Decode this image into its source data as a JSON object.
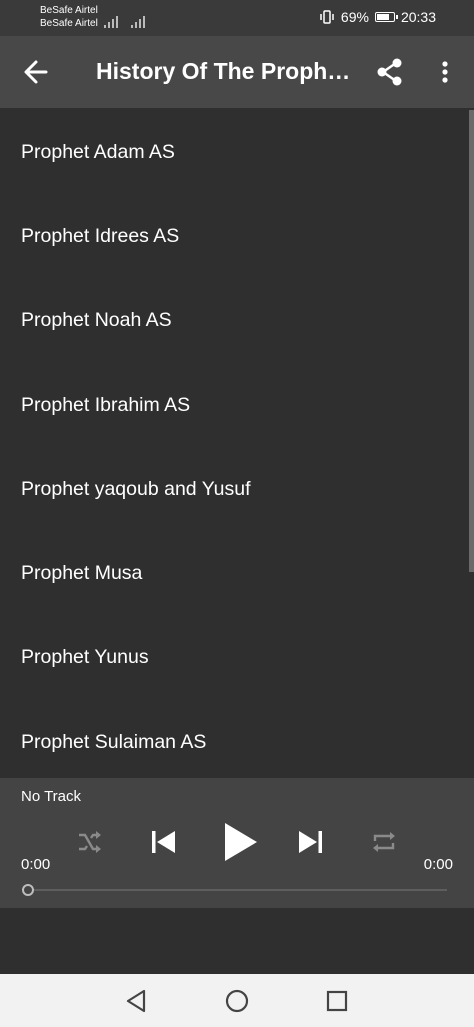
{
  "status_bar": {
    "carrier_1": "BeSafe Airtel",
    "carrier_2": "BeSafe Airtel",
    "battery_percent": "69%",
    "time": "20:33"
  },
  "app_bar": {
    "title": "History Of The Prophets",
    "back_icon": "arrow-left-icon",
    "share_icon": "share-icon",
    "more_icon": "more-vertical-icon"
  },
  "list": {
    "items": [
      "Prophet Adam AS",
      "Prophet Idrees AS",
      "Prophet Noah AS",
      "Prophet Ibrahim AS",
      "Prophet yaqoub and Yusuf",
      "Prophet Musa",
      "Prophet Yunus",
      "Prophet Sulaiman AS"
    ]
  },
  "player": {
    "track": "No Track",
    "elapsed": "0:00",
    "duration": "0:00",
    "progress": 0
  },
  "colors": {
    "background": "#2f2f2f",
    "app_bar": "#484848",
    "player": "#444444",
    "text": "#ffffff",
    "disabled_icon": "#8a8a8a"
  }
}
